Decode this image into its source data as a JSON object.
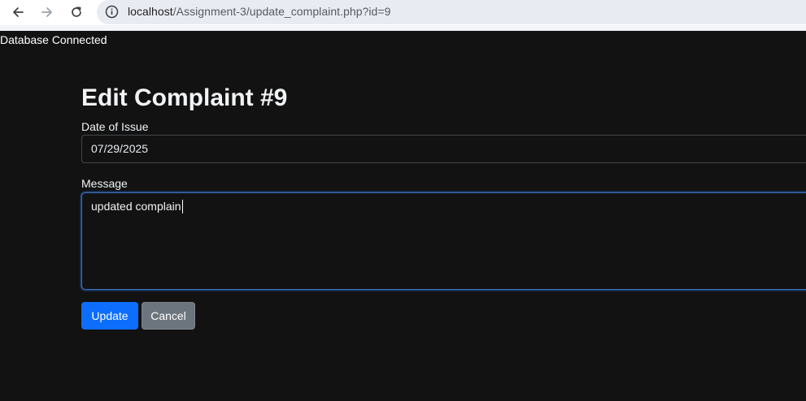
{
  "browser": {
    "url_host": "localhost",
    "url_path": "/Assignment-3/update_complaint.php?id=9",
    "icons": {
      "back": "back-arrow-icon",
      "forward": "forward-arrow-icon",
      "reload": "reload-icon",
      "site_info": "info-icon"
    }
  },
  "page": {
    "db_status": "Database Connected",
    "title": "Edit Complaint #9",
    "form": {
      "date_label": "Date of Issue",
      "date_value": "07/29/2025",
      "message_label": "Message",
      "message_value": "updated complain",
      "update_label": "Update",
      "cancel_label": "Cancel"
    }
  },
  "colors": {
    "page_background": "#121212",
    "primary_button": "#0d6efd",
    "secondary_button": "#6c757d",
    "focus_border": "#3f6fb5"
  }
}
